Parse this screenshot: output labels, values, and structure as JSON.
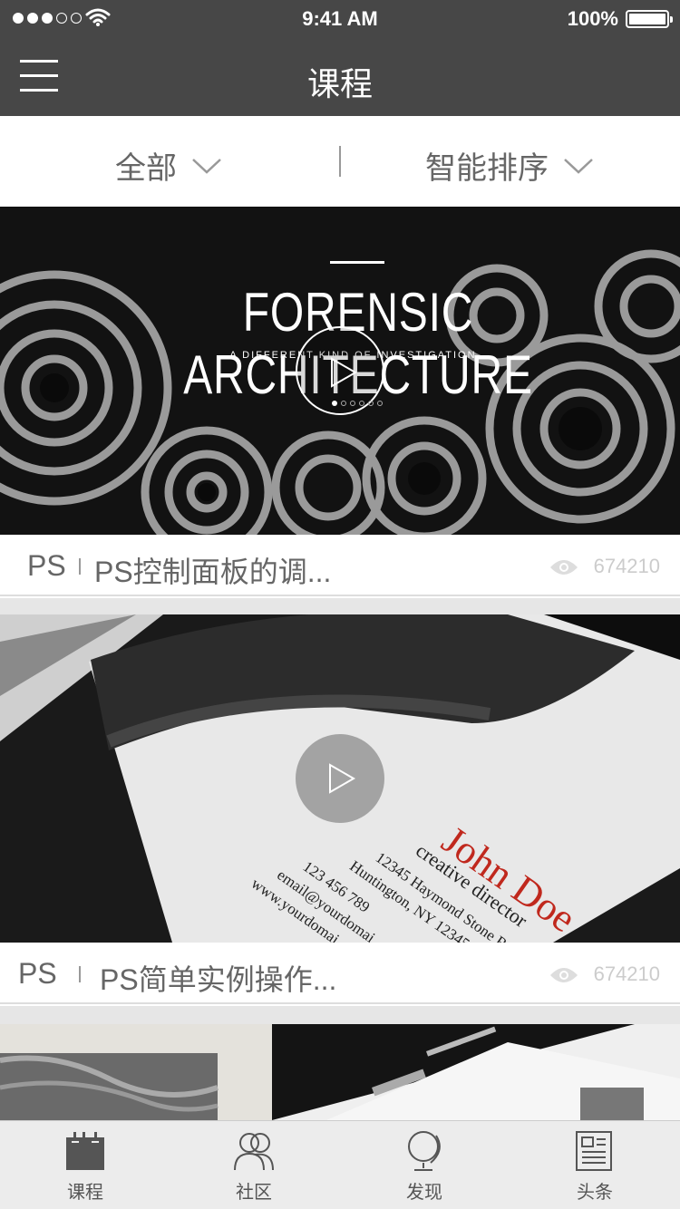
{
  "status_bar": {
    "time": "9:41 AM",
    "battery": "100%"
  },
  "nav": {
    "title": "课程",
    "menu_icon": "hamburger-icon"
  },
  "filters": {
    "category": "全部",
    "sort": "智能排序"
  },
  "cards": [
    {
      "category": "PS",
      "title": "PS控制面板的调...",
      "views": "674210",
      "banner_title": "FORENSIC ARCHITECTURE",
      "banner_subtitle": "A DIFFERENT KIND OF INVESTIGATION."
    },
    {
      "category": "PS",
      "title": "PS简单实例操作...",
      "views": "674210",
      "card_name": "John Doe",
      "card_role": "creative director",
      "card_address": "12345 Haymond Stone R",
      "card_city": "Huntington, NY 12345",
      "card_phone": "123 456 789",
      "card_email": "email@yourdomai",
      "card_web": "www.yourdomai"
    }
  ],
  "tabs": [
    {
      "label": "课程",
      "icon": "calendar-icon"
    },
    {
      "label": "社区",
      "icon": "community-icon"
    },
    {
      "label": "发现",
      "icon": "globe-icon"
    },
    {
      "label": "头条",
      "icon": "news-icon"
    }
  ],
  "colors": {
    "header": "#474747",
    "accent_red": "#c0281d"
  }
}
